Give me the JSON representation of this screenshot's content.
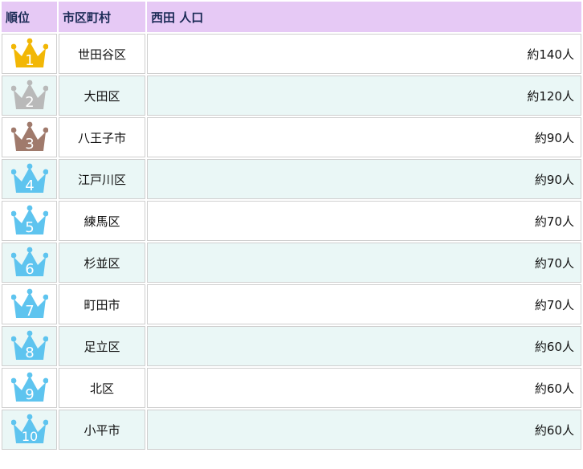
{
  "headers": {
    "rank": "順位",
    "city": "市区町村",
    "pop": "西田 人口"
  },
  "rows": [
    {
      "rank": "1",
      "city": "世田谷区",
      "pop": "約140人",
      "crown": "gold"
    },
    {
      "rank": "2",
      "city": "大田区",
      "pop": "約120人",
      "crown": "silver"
    },
    {
      "rank": "3",
      "city": "八王子市",
      "pop": "約90人",
      "crown": "bronze"
    },
    {
      "rank": "4",
      "city": "江戸川区",
      "pop": "約90人",
      "crown": "blue"
    },
    {
      "rank": "5",
      "city": "練馬区",
      "pop": "約70人",
      "crown": "blue"
    },
    {
      "rank": "6",
      "city": "杉並区",
      "pop": "約70人",
      "crown": "blue"
    },
    {
      "rank": "7",
      "city": "町田市",
      "pop": "約70人",
      "crown": "blue"
    },
    {
      "rank": "8",
      "city": "足立区",
      "pop": "約60人",
      "crown": "blue"
    },
    {
      "rank": "9",
      "city": "北区",
      "pop": "約60人",
      "crown": "blue"
    },
    {
      "rank": "10",
      "city": "小平市",
      "pop": "約60人",
      "crown": "blue"
    }
  ],
  "colors": {
    "gold": "#f2b705",
    "silver": "#b9b9b9",
    "bronze": "#a07a6c",
    "blue": "#5ec4ef",
    "header_bg": "#e6c9f5",
    "even_row_bg": "#eaf7f6"
  }
}
